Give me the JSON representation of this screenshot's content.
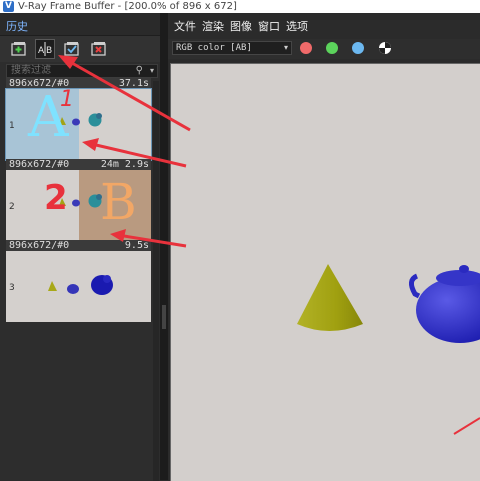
{
  "window": {
    "title": "V-Ray Frame Buffer - [200.0% of 896 x 672]"
  },
  "left_panel": {
    "tab_label": "历史",
    "search_placeholder": "搜索过滤",
    "items": [
      {
        "resolution": "896x672/#0",
        "time": "37.1s",
        "index": "1",
        "annotation_letter": "A",
        "annotation_mark": "1"
      },
      {
        "resolution": "896x672/#0",
        "time": "24m 2.9s",
        "index": "2",
        "annotation_letter": "B",
        "annotation_mark": "2"
      },
      {
        "resolution": "896x672/#0",
        "time": "9.5s",
        "index": "3"
      }
    ]
  },
  "menu": [
    "文件",
    "渲染",
    "图像",
    "窗口",
    "选项"
  ],
  "viewer": {
    "channel": "RGB color [AB]"
  },
  "colors": {
    "red_channel": "#f06a6a",
    "green_channel": "#5cd35c",
    "blue_channel": "#6cb8f0",
    "arrow": "#e8323c",
    "accent_tab": "#7fb6ff"
  }
}
